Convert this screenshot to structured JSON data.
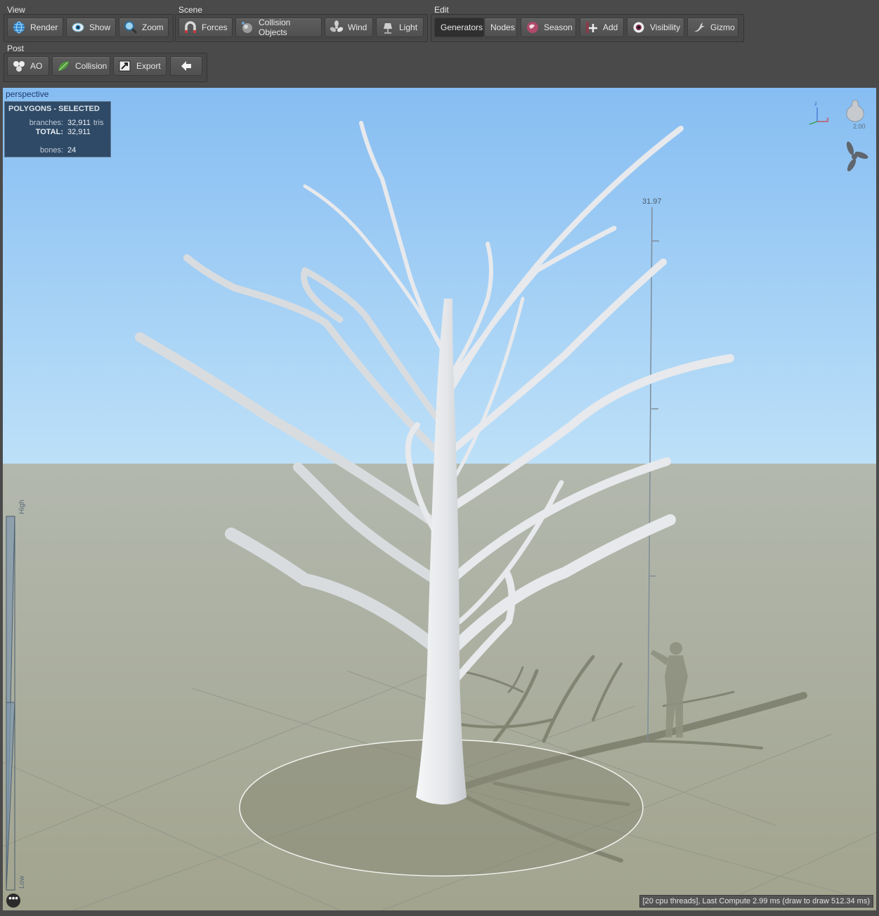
{
  "toolbar": {
    "view": {
      "label": "View",
      "buttons": [
        {
          "label": "Render",
          "icon": "globe-icon"
        },
        {
          "label": "Show",
          "icon": "eye-icon"
        },
        {
          "label": "Zoom",
          "icon": "magnifier-icon"
        }
      ]
    },
    "scene": {
      "label": "Scene",
      "buttons": [
        {
          "label": "Forces",
          "icon": "magnet-icon"
        },
        {
          "label": "Collision Objects",
          "icon": "sphere-icon"
        },
        {
          "label": "Wind",
          "icon": "fan-icon"
        },
        {
          "label": "Light",
          "icon": "lamp-icon"
        }
      ]
    },
    "edit": {
      "label": "Edit",
      "buttons": [
        {
          "label": "Generators",
          "active": true
        },
        {
          "label": "Nodes"
        },
        {
          "label": "Season",
          "icon": "season-globe-icon"
        },
        {
          "label": "Add",
          "icon": "add-node-icon"
        },
        {
          "label": "Visibility",
          "icon": "eyeball-icon"
        },
        {
          "label": "Gizmo",
          "icon": "gizmo-icon"
        }
      ]
    },
    "post": {
      "label": "Post",
      "buttons": [
        {
          "label": "AO",
          "icon": "ao-spheres-icon"
        },
        {
          "label": "Collision",
          "icon": "leaf-collision-icon"
        },
        {
          "label": "Export",
          "icon": "export-icon"
        },
        {
          "label": "",
          "icon": "back-arrow-icon"
        }
      ]
    }
  },
  "viewport": {
    "camera_label": "perspective",
    "stats": {
      "header": "POLYGONS - SELECTED",
      "branches_label": "branches:",
      "branches_value": "32,911",
      "branches_unit": "tris",
      "total_label": "TOTAL:",
      "total_value": "32,911",
      "bones_label": "bones:",
      "bones_value": "24"
    },
    "height_scale_value": "31.97",
    "gizmo_value": "2.00",
    "axis_labels": {
      "z": "z",
      "x": "x"
    },
    "lod_high": "High",
    "lod_low": "Low",
    "more_button": "•••",
    "status_bar": "[20 cpu threads], Last Compute 2.99 ms (draw to draw 512.34 ms)"
  },
  "colors": {
    "sky_top": "#8cc2f4",
    "sky_bottom": "#b9dcf7",
    "ground": "#a6a894",
    "tree": "#e9ebed",
    "toolbar_bg": "#4a4a4a",
    "stats_bg": "#2f4a66"
  }
}
